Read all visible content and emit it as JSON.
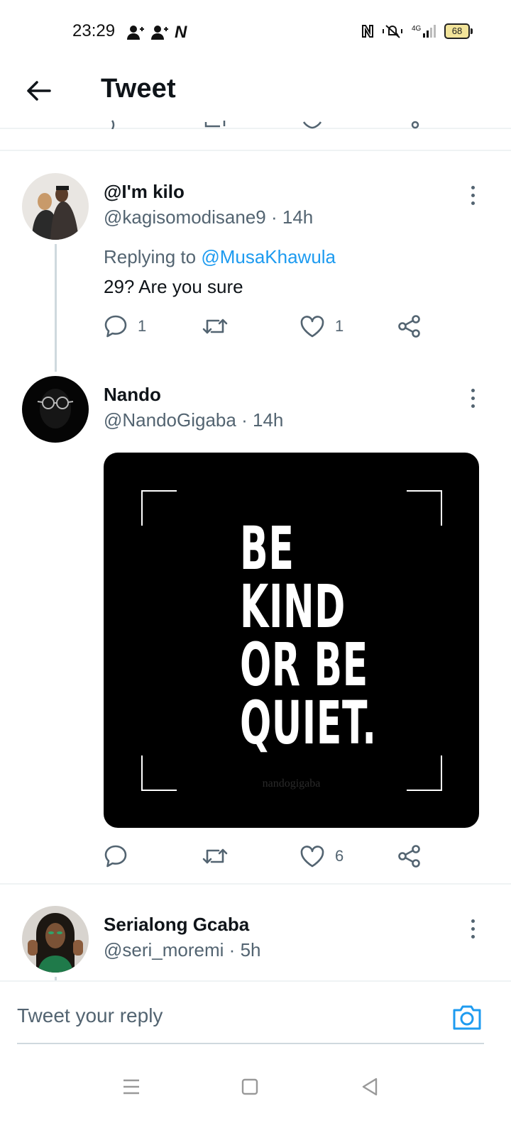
{
  "status_bar": {
    "time": "23:29",
    "battery": "68",
    "network": "4G",
    "left_icons": [
      "person-add-icon",
      "person-add-icon",
      "netflix-icon"
    ],
    "right_icons": [
      "nfc-icon",
      "vibrate-mute-icon",
      "signal-icon",
      "battery-icon"
    ]
  },
  "header": {
    "title": "Tweet",
    "back_icon": "arrow-left-icon"
  },
  "tweets": [
    {
      "display_name": "@I'm kilo",
      "handle": "@kagisomodisane9",
      "time": "14h",
      "replying_prefix": "Replying to",
      "replying_to": "@MusaKhawula",
      "text": "29? Are you sure",
      "reply_count": "1",
      "retweet_count": "",
      "like_count": "1"
    },
    {
      "display_name": "Nando",
      "handle": "@NandoGigaba",
      "time": "14h",
      "media": {
        "quote": "BE\nKIND\nOR BE\nQUIET.",
        "watermark": "nandogigaba"
      },
      "reply_count": "",
      "retweet_count": "",
      "like_count": "6"
    },
    {
      "display_name": "Serialong Gcaba",
      "handle": "@seri_moremi",
      "time": "5h"
    }
  ],
  "composer": {
    "placeholder": "Tweet your reply",
    "camera_icon": "camera-icon"
  },
  "nav_bar": {
    "icons": [
      "menu-icon",
      "home-square-icon",
      "back-triangle-icon"
    ]
  },
  "colors": {
    "accent": "#1d9bf0",
    "text_primary": "#0f1419",
    "text_secondary": "#536471",
    "divider": "#eff3f4"
  }
}
